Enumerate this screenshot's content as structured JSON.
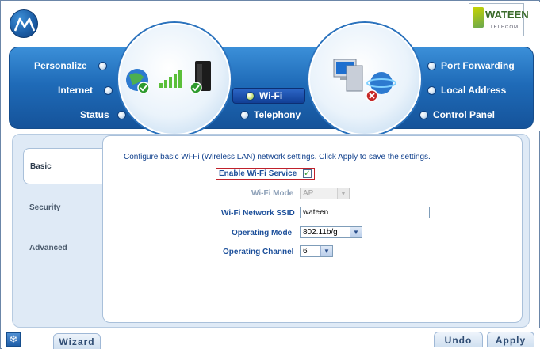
{
  "brand": {
    "logo_icon": "motorola-logo-icon",
    "partner_name": "WATEEN",
    "partner_sub": "TELECOM"
  },
  "nav_left": [
    {
      "label": "Personalize"
    },
    {
      "label": "Internet"
    },
    {
      "label": "Status"
    }
  ],
  "nav_center": [
    {
      "label": "Wi-Fi",
      "active": true
    },
    {
      "label": "Telephony"
    }
  ],
  "nav_right": [
    {
      "label": "Port Forwarding"
    },
    {
      "label": "Local Address"
    },
    {
      "label": "Control Panel"
    }
  ],
  "side_tabs": [
    {
      "label": "Basic",
      "active": true
    },
    {
      "label": "Security"
    },
    {
      "label": "Advanced"
    }
  ],
  "form": {
    "intro": "Configure basic Wi-Fi (Wireless LAN) network settings. Click Apply to save the settings.",
    "enable_label": "Enable Wi-Fi Service",
    "enable_checked": true,
    "mode_label": "Wi-Fi Mode",
    "mode_value": "AP",
    "ssid_label": "Wi-Fi Network SSID",
    "ssid_value": "wateen",
    "opmode_label": "Operating Mode",
    "opmode_value": "802.11b/g",
    "channel_label": "Operating Channel",
    "channel_value": "6"
  },
  "footer": {
    "wizard": "Wizard",
    "undo": "Undo",
    "apply": "Apply"
  },
  "colors": {
    "nav_blue": "#1f6bb8",
    "label_blue": "#1c4f9a",
    "highlight_red": "#c0212b"
  }
}
